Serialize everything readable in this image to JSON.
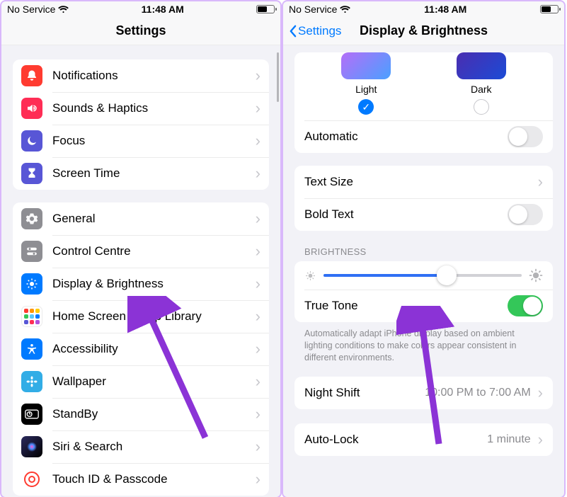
{
  "status": {
    "carrier": "No Service",
    "time": "11:48 AM"
  },
  "screen1": {
    "title": "Settings",
    "groups": [
      [
        {
          "key": "notifications",
          "label": "Notifications"
        },
        {
          "key": "sounds",
          "label": "Sounds & Haptics"
        },
        {
          "key": "focus",
          "label": "Focus"
        },
        {
          "key": "screentime",
          "label": "Screen Time"
        }
      ],
      [
        {
          "key": "general",
          "label": "General"
        },
        {
          "key": "control",
          "label": "Control Centre"
        },
        {
          "key": "display",
          "label": "Display & Brightness"
        },
        {
          "key": "homescreen",
          "label": "Home Screen & App Library"
        },
        {
          "key": "accessibility",
          "label": "Accessibility"
        },
        {
          "key": "wallpaper",
          "label": "Wallpaper"
        },
        {
          "key": "standby",
          "label": "StandBy"
        },
        {
          "key": "siri",
          "label": "Siri & Search"
        },
        {
          "key": "touchid",
          "label": "Touch ID & Passcode"
        }
      ]
    ]
  },
  "screen2": {
    "back": "Settings",
    "title": "Display & Brightness",
    "appearance": {
      "light_label": "Light",
      "dark_label": "Dark",
      "selected": "light",
      "automatic_label": "Automatic",
      "automatic_on": false
    },
    "text": {
      "size_label": "Text Size",
      "bold_label": "Bold Text",
      "bold_on": false
    },
    "brightness": {
      "header": "BRIGHTNESS",
      "level": 0.62,
      "truetone_label": "True Tone",
      "truetone_on": true,
      "footnote": "Automatically adapt iPhone display based on ambient lighting conditions to make colors appear consistent in different environments."
    },
    "night_shift": {
      "label": "Night Shift",
      "value": "10:00 PM to 7:00 AM"
    },
    "autolock": {
      "label": "Auto-Lock",
      "value": "1 minute"
    }
  }
}
